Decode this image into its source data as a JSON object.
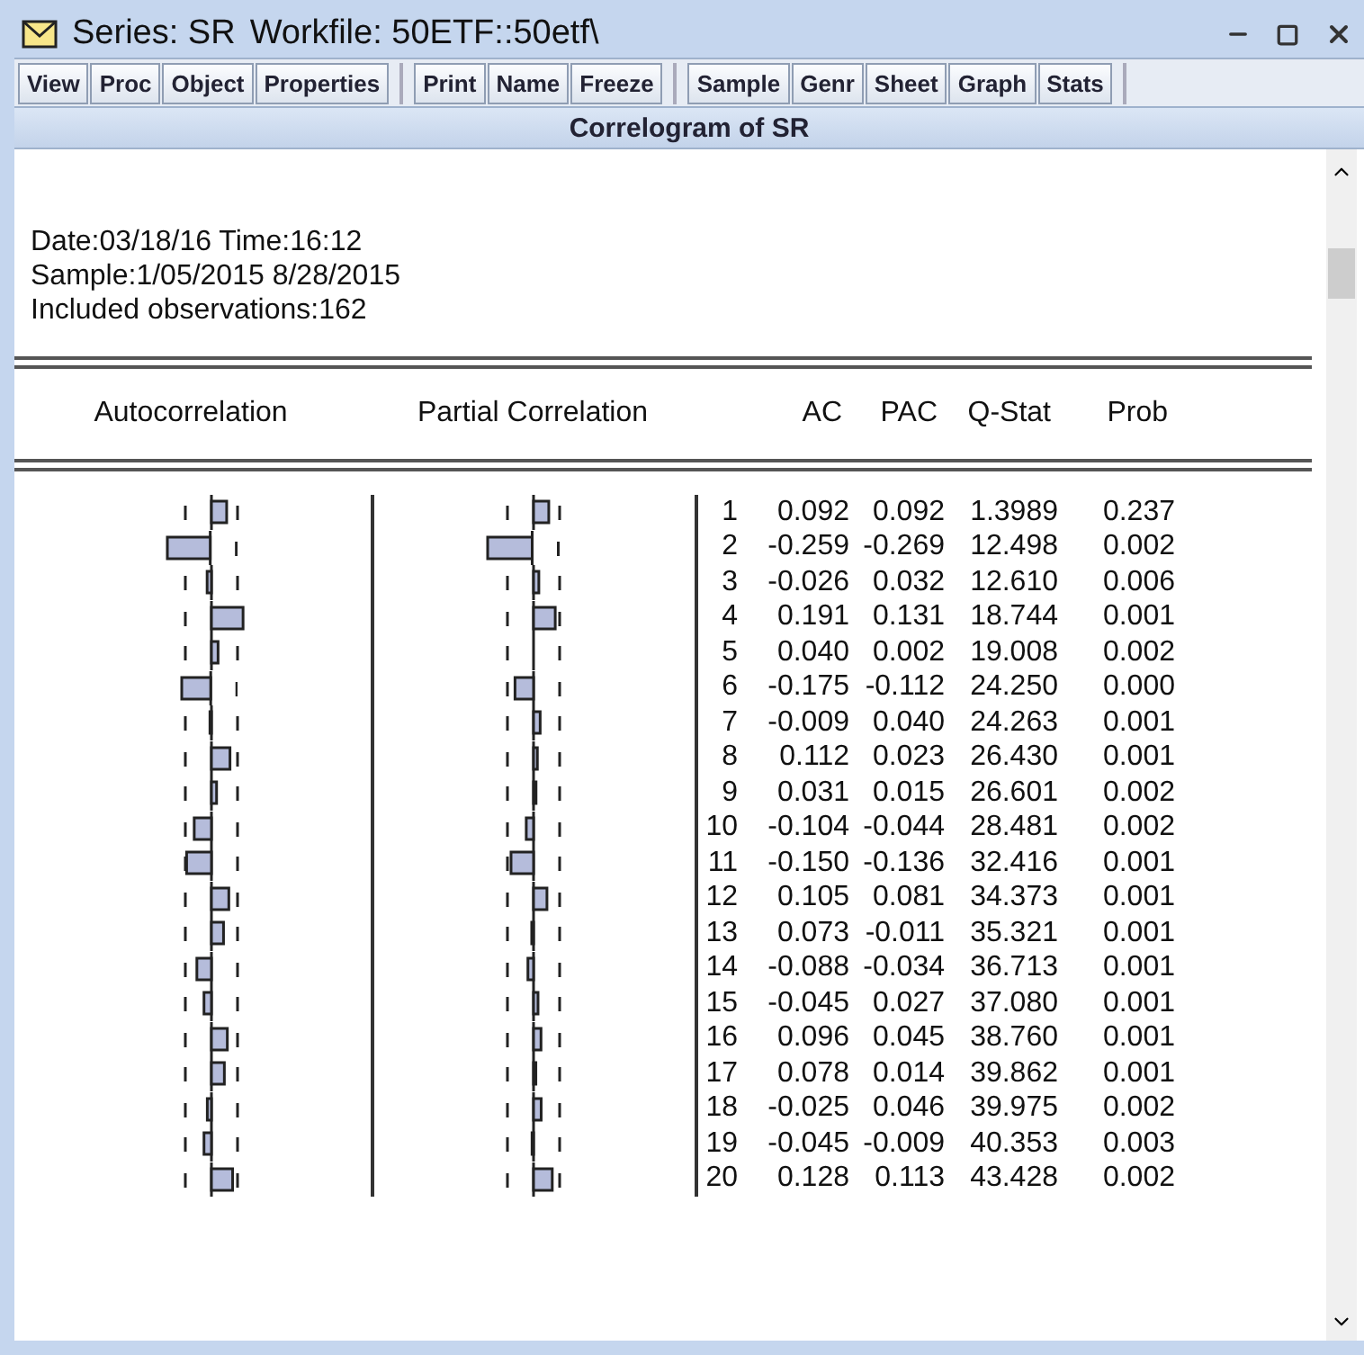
{
  "window": {
    "title_series": "Series: SR",
    "title_workfile": "Workfile: 50ETF::50etf\\"
  },
  "toolbar": [
    [
      "View",
      "Proc",
      "Object",
      "Properties"
    ],
    [
      "Print",
      "Name",
      "Freeze"
    ],
    [
      "Sample",
      "Genr",
      "Sheet",
      "Graph",
      "Stats"
    ]
  ],
  "view_title": "Correlogram of SR",
  "info": [
    "Date:03/18/16 Time:16:12",
    "Sample:1/05/2015 8/28/2015",
    "Included observations:162"
  ],
  "columns": [
    "Autocorrelation",
    "Partial Correlation",
    "AC",
    "PAC",
    "Q-Stat",
    "Prob"
  ],
  "rows": [
    {
      "lag": "1",
      "ac": "0.092",
      "pac": "0.092",
      "q_stat": "1.3989",
      "prob": "0.237"
    },
    {
      "lag": "2",
      "ac": "-0.259",
      "pac": "-0.269",
      "q_stat": "12.498",
      "prob": "0.002"
    },
    {
      "lag": "3",
      "ac": "-0.026",
      "pac": "0.032",
      "q_stat": "12.610",
      "prob": "0.006"
    },
    {
      "lag": "4",
      "ac": "0.191",
      "pac": "0.131",
      "q_stat": "18.744",
      "prob": "0.001"
    },
    {
      "lag": "5",
      "ac": "0.040",
      "pac": "0.002",
      "q_stat": "19.008",
      "prob": "0.002"
    },
    {
      "lag": "6",
      "ac": "-0.175",
      "pac": "-0.112",
      "q_stat": "24.250",
      "prob": "0.000"
    },
    {
      "lag": "7",
      "ac": "-0.009",
      "pac": "0.040",
      "q_stat": "24.263",
      "prob": "0.001"
    },
    {
      "lag": "8",
      "ac": "0.112",
      "pac": "0.023",
      "q_stat": "26.430",
      "prob": "0.001"
    },
    {
      "lag": "9",
      "ac": "0.031",
      "pac": "0.015",
      "q_stat": "26.601",
      "prob": "0.002"
    },
    {
      "lag": "10",
      "ac": "-0.104",
      "pac": "-0.044",
      "q_stat": "28.481",
      "prob": "0.002"
    },
    {
      "lag": "11",
      "ac": "-0.150",
      "pac": "-0.136",
      "q_stat": "32.416",
      "prob": "0.001"
    },
    {
      "lag": "12",
      "ac": "0.105",
      "pac": "0.081",
      "q_stat": "34.373",
      "prob": "0.001"
    },
    {
      "lag": "13",
      "ac": "0.073",
      "pac": "-0.011",
      "q_stat": "35.321",
      "prob": "0.001"
    },
    {
      "lag": "14",
      "ac": "-0.088",
      "pac": "-0.034",
      "q_stat": "36.713",
      "prob": "0.001"
    },
    {
      "lag": "15",
      "ac": "-0.045",
      "pac": "0.027",
      "q_stat": "37.080",
      "prob": "0.001"
    },
    {
      "lag": "16",
      "ac": "0.096",
      "pac": "0.045",
      "q_stat": "38.760",
      "prob": "0.001"
    },
    {
      "lag": "17",
      "ac": "0.078",
      "pac": "0.014",
      "q_stat": "39.862",
      "prob": "0.001"
    },
    {
      "lag": "18",
      "ac": "-0.025",
      "pac": "0.046",
      "q_stat": "39.975",
      "prob": "0.002"
    },
    {
      "lag": "19",
      "ac": "-0.045",
      "pac": "-0.009",
      "q_stat": "40.353",
      "prob": "0.003"
    },
    {
      "lag": "20",
      "ac": "0.128",
      "pac": "0.113",
      "q_stat": "43.428",
      "prob": "0.002"
    }
  ]
}
